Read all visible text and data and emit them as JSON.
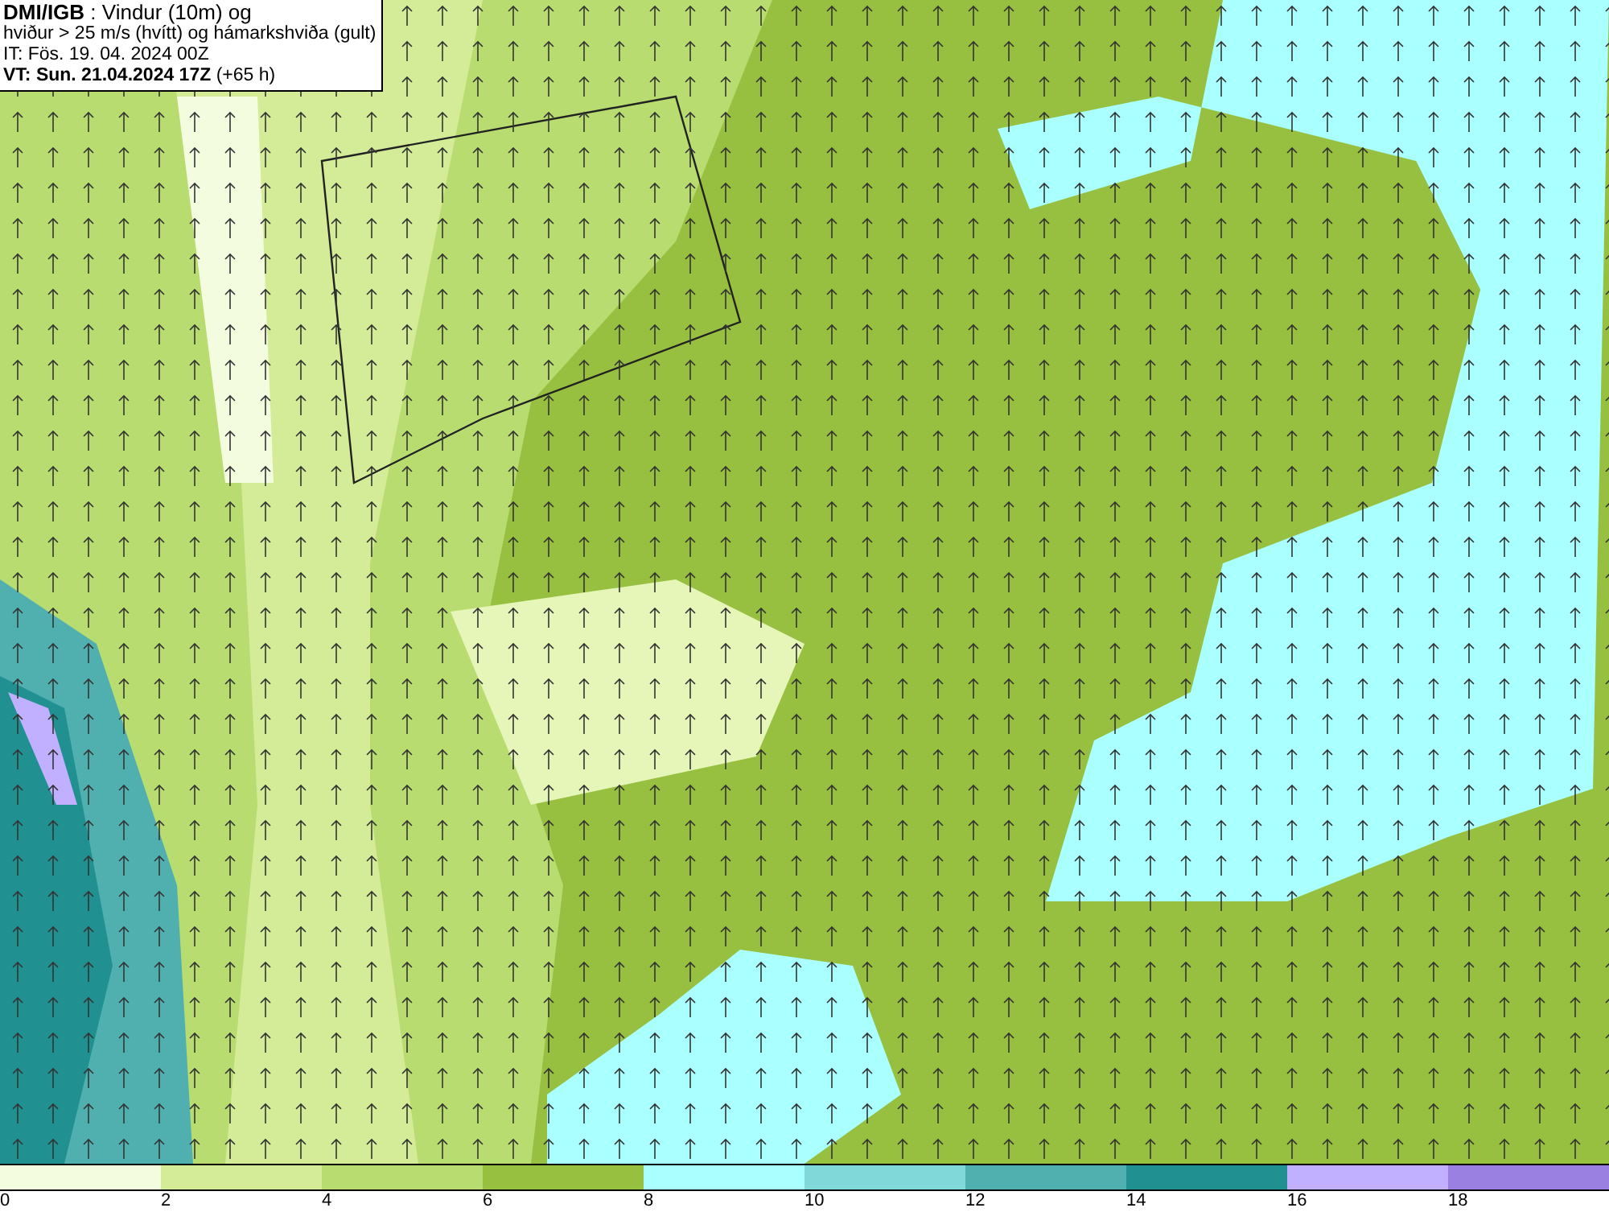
{
  "header": {
    "lines": [
      "**DMI/IGB** : Vindur (10m) og",
      "hviður > 25 m/s (hvítt) og hámarkshviða (gult)",
      "IT: Fös. 19. 04. 2024 00Z",
      "**VT: Sun. 21.04.2024 17Z** (+65 h)"
    ]
  },
  "legend": {
    "bins": [
      {
        "color": "#f4fce0"
      },
      {
        "color": "#d4ec98"
      },
      {
        "color": "#b8dc70"
      },
      {
        "color": "#98c040"
      },
      {
        "color": "#aaffff"
      },
      {
        "color": "#80d8d8"
      },
      {
        "color": "#50b0b0"
      },
      {
        "color": "#209090"
      },
      {
        "color": "#c0b0ff"
      },
      {
        "color": "#9a80e0"
      }
    ],
    "ticks": [
      "0",
      "2",
      "4",
      "6",
      "8",
      "10",
      "12",
      "14",
      "16",
      "18"
    ]
  }
}
